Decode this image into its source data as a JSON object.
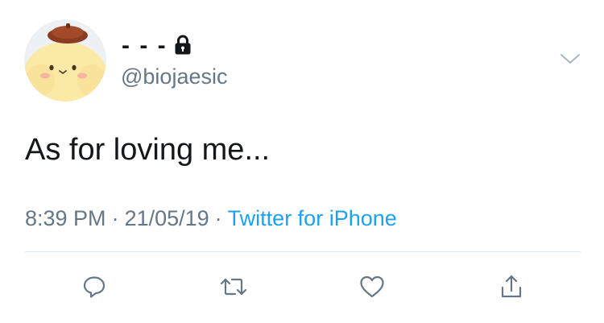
{
  "tweet": {
    "author": {
      "display_name": "- - -",
      "handle": "@biojaesic",
      "avatar_icon": "pompompurin-avatar",
      "protected_icon": "lock-icon"
    },
    "text": "As for loving me...",
    "time": "8:39 PM",
    "date": "21/05/19",
    "separator": "·",
    "source": "Twitter for iPhone"
  },
  "menu": {
    "icon": "chevron-down-icon"
  },
  "actions": [
    {
      "name": "reply",
      "icon": "reply-icon"
    },
    {
      "name": "retweet",
      "icon": "retweet-icon"
    },
    {
      "name": "like",
      "icon": "heart-icon"
    },
    {
      "name": "share",
      "icon": "share-icon"
    }
  ],
  "colors": {
    "text": "#14171a",
    "secondary": "#657786",
    "link": "#1da1f2",
    "divider": "#e1e8ed"
  }
}
